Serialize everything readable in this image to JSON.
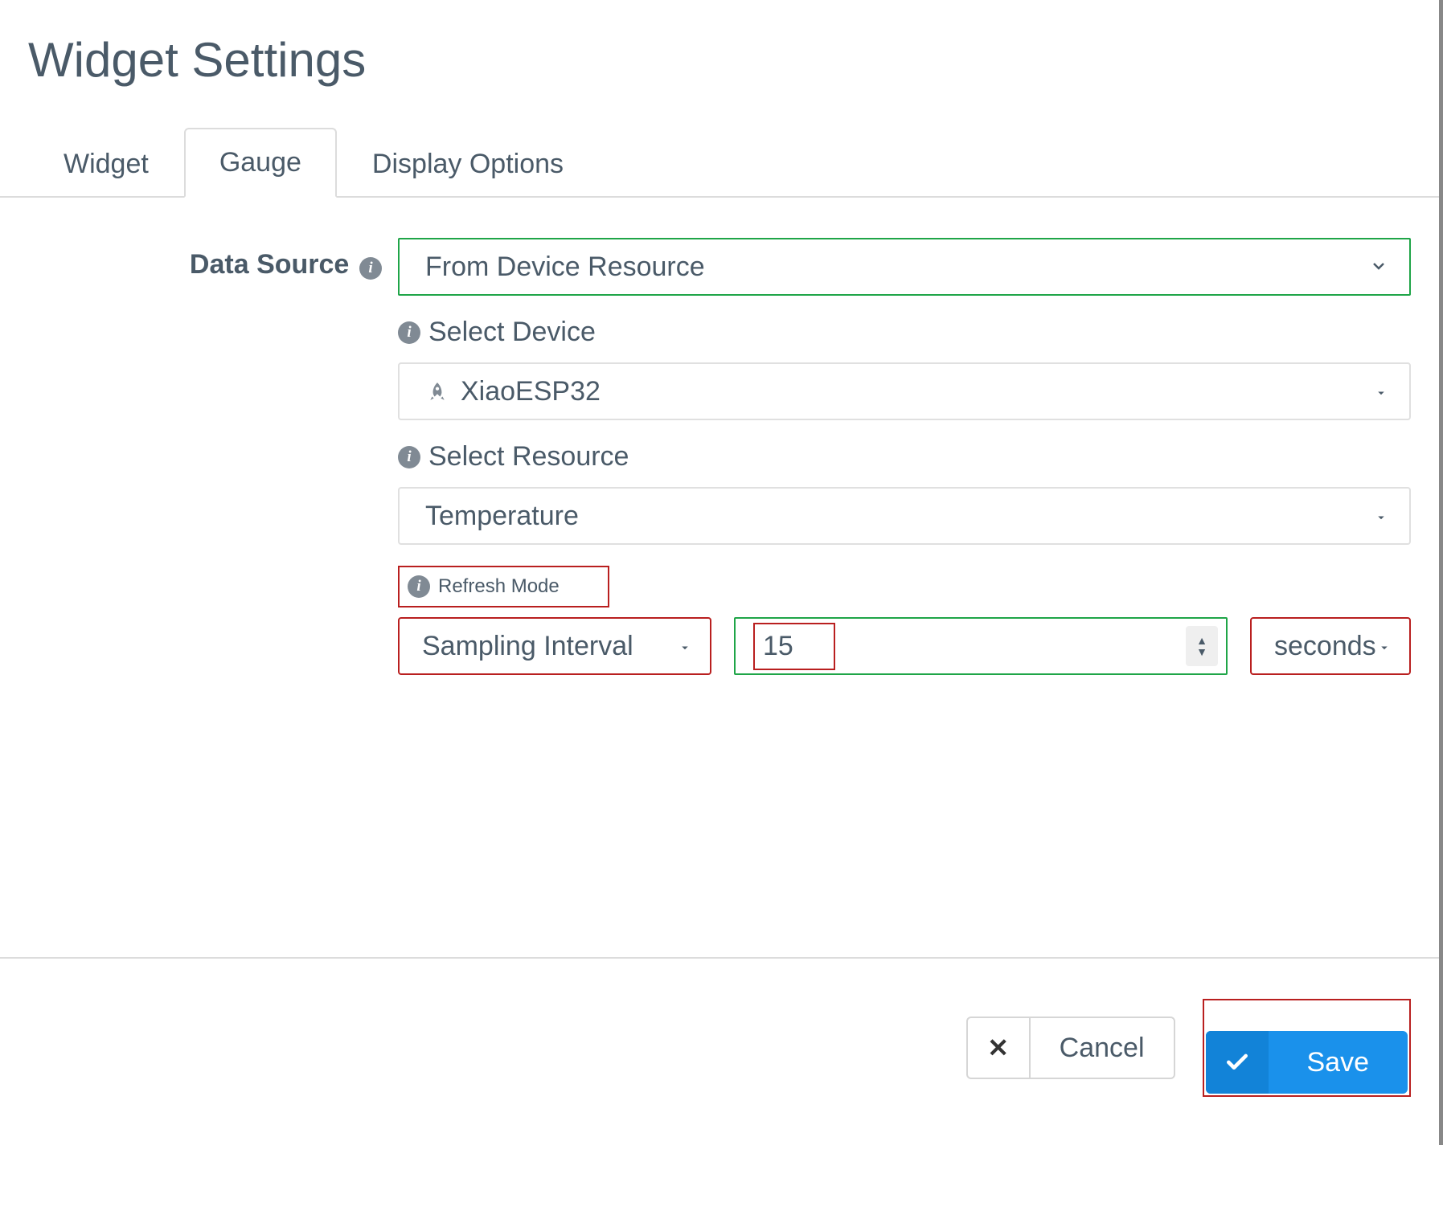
{
  "header": {
    "title": "Widget Settings"
  },
  "tabs": {
    "widget": "Widget",
    "gauge": "Gauge",
    "display_options": "Display Options"
  },
  "form": {
    "data_source_label": "Data Source",
    "data_source_value": "From Device Resource",
    "select_device_label": "Select Device",
    "select_device_value": "XiaoESP32",
    "select_resource_label": "Select Resource",
    "select_resource_value": "Temperature",
    "refresh_mode_label": "Refresh Mode",
    "refresh_mode_value": "Sampling Interval",
    "refresh_interval_value": "15",
    "refresh_unit_value": "seconds"
  },
  "footer": {
    "cancel": "Cancel",
    "save": "Save"
  }
}
